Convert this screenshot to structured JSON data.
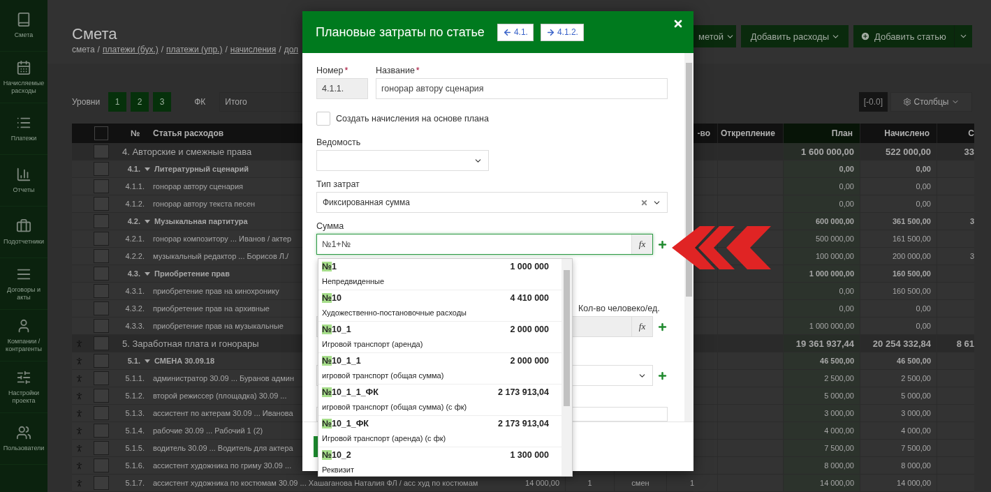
{
  "sidebar": {
    "items": [
      {
        "label": "Смета"
      },
      {
        "label": "Начисляемые расходы"
      },
      {
        "label": "Платежи"
      },
      {
        "label": "Отчеты"
      },
      {
        "label": "Подотчетники"
      },
      {
        "label": "Договоры и акты"
      },
      {
        "label": "Компании / контрагенты"
      },
      {
        "label": "Настройки проекта"
      },
      {
        "label": "Пользователи"
      }
    ]
  },
  "page": {
    "title": "Смета",
    "breadcrumbs": [
      {
        "label": "смета",
        "link": false
      },
      {
        "label": "платежи (бух.)",
        "link": true
      },
      {
        "label": "платежи (упр.)",
        "link": true
      },
      {
        "label": "начисления",
        "link": true
      },
      {
        "label": "дол",
        "link": true
      }
    ],
    "separator": "/"
  },
  "actions": [
    {
      "label": "метой",
      "kind": "dropdown"
    },
    {
      "label": "Добавить расходы",
      "kind": "dropdown"
    },
    {
      "label": "Добавить статью",
      "kind": "split"
    }
  ],
  "toolbar": {
    "levels_label": "Уровни",
    "levels": [
      "1",
      "2",
      "3"
    ],
    "fk_label": "ФК",
    "fk_value": "Итого",
    "precision": "[-0.0]",
    "columns_button": "Столбцы"
  },
  "table": {
    "header": {
      "checked": false,
      "number": "№",
      "name": "Статья расходов",
      "column_8": "-во",
      "detach": "Открепление",
      "plan": "План",
      "accrued": "Начислено",
      "column_12": "С"
    },
    "rows": [
      {
        "kind": "group",
        "person": false,
        "checked": false,
        "name": "4. Авторские и смежные права",
        "plan": "1 600 000,00",
        "accrued": "522 000,00",
        "column_12": "33"
      },
      {
        "kind": "subgroup",
        "person": false,
        "checked": false,
        "num": "4.1.",
        "name": "Литературный сценарий",
        "plan": "0,00",
        "accrued": "0,00"
      },
      {
        "kind": "item",
        "person": false,
        "checked": false,
        "num": "4.1.1.",
        "name": "гонорар автору сценария",
        "plan": "0,00",
        "accrued": "0,00"
      },
      {
        "kind": "item",
        "person": false,
        "checked": false,
        "num": "4.1.2.",
        "name": "гонорар автору текста песен",
        "plan": "0,00",
        "accrued": "0,00"
      },
      {
        "kind": "subgroup",
        "person": false,
        "checked": false,
        "num": "4.2.",
        "name": "Музыкальная партитура",
        "plan": "600 000,00",
        "accrued": "361 500,00",
        "column_12": "3"
      },
      {
        "kind": "item",
        "person": false,
        "checked": false,
        "num": "4.2.1.",
        "name": "гонорар композитору ... Иванов / актер",
        "plan": "500 000,00",
        "accrued": "161 500,00"
      },
      {
        "kind": "item",
        "person": false,
        "checked": false,
        "num": "4.2.2.",
        "name": "музыкальный редактор ... Борисов Л./",
        "plan": "100 000,00",
        "accrued": "200 000,00",
        "column_12": "3"
      },
      {
        "kind": "subgroup",
        "person": false,
        "checked": false,
        "num": "4.3.",
        "name": "Приобретение прав",
        "plan": "1 000 000,00",
        "accrued": "160 500,00"
      },
      {
        "kind": "item",
        "person": false,
        "checked": false,
        "num": "4.3.1.",
        "name": "приобретение прав на кинохронику",
        "plan": "0,00",
        "accrued": "160 500,00"
      },
      {
        "kind": "item",
        "person": false,
        "checked": false,
        "num": "4.3.2.",
        "name": "приобретение прав на архивные",
        "plan": "0,00",
        "accrued": "0,00"
      },
      {
        "kind": "item",
        "person": false,
        "checked": false,
        "num": "4.3.3.",
        "name": "приобретение прав на музыкальные",
        "plan": "1 000 000,00",
        "accrued": "0,00"
      },
      {
        "kind": "group",
        "person": true,
        "checked": false,
        "name": "5. Заработная плата и гонорары",
        "plan": "19 361 937,44",
        "accrued": "20 254 332,84",
        "column_12": "8 61"
      },
      {
        "kind": "subgroup",
        "person": true,
        "checked": false,
        "num": "5.1.",
        "name": "СМЕНА 30.09.18",
        "plan": "46 500,00",
        "accrued": "46 500,00"
      },
      {
        "kind": "item",
        "person": true,
        "checked": false,
        "num": "5.1.1.",
        "name": "администратор 30.09 ... Буранов админ",
        "plan": "2 500,00",
        "accrued": "2 500,00"
      },
      {
        "kind": "item",
        "person": true,
        "checked": false,
        "num": "5.1.2.",
        "name": "второй режиссер (площадка) 30.09 ...",
        "plan": "5 000,00",
        "accrued": "5 000,00"
      },
      {
        "kind": "item",
        "person": true,
        "checked": false,
        "num": "5.1.3.",
        "name": "ассистент по актерам 30.09 ... Иванова",
        "plan": "3 000,00",
        "accrued": "3 000,00"
      },
      {
        "kind": "item",
        "person": true,
        "checked": false,
        "num": "5.1.4.",
        "name": "рабочие 30.09 ... Рабочий 1 (2)",
        "plan": "4 000,00",
        "accrued": "4 000,00"
      },
      {
        "kind": "item",
        "person": true,
        "checked": false,
        "num": "5.1.5.",
        "name": "водитель 30.09 ... Водитель для актера",
        "plan": "7 500,00",
        "accrued": "7 500,00"
      },
      {
        "kind": "item",
        "person": true,
        "checked": false,
        "num": "5.1.6.",
        "name": "ассистент художника по гриму 30.09 ...",
        "plan": "8 000,00",
        "accrued": "8 000,00"
      },
      {
        "kind": "item",
        "person": true,
        "checked": false,
        "num": "5.1.7.",
        "name": "ассистент художника по костюмам 30.09 ... Хашаганова Наталия ФЛ / асс худ по костюмам",
        "price": "14 000,00",
        "qty": "1",
        "unit": "смен",
        "column_8": "1",
        "plan": "14 000,00",
        "accrued": "14 000,00"
      }
    ]
  },
  "modal": {
    "title": "Плановые затраты по статье",
    "prev": "4.1.",
    "next": "4.1.2.",
    "number": {
      "label": "Номер",
      "mark": "*",
      "value": "4.1.1.",
      "disabled": true
    },
    "name": {
      "label": "Название",
      "mark": "*",
      "value": "гонорар автору сценария"
    },
    "create_accruals": {
      "label": "Создать начисления на основе плана",
      "checked": false
    },
    "statement": {
      "label": "Ведомость"
    },
    "cost_type": {
      "label": "Тип затрат",
      "value": "Фиксированная сумма"
    },
    "sum": {
      "label": "Сумма",
      "value": "№1+№",
      "button": "fx",
      "focused": true
    },
    "qty": {
      "label": "Кол-во человеко/ед.",
      "button": "fx"
    },
    "suggestions": [
      {
        "match": "№",
        "rest": "1",
        "name": "Непредвиденные",
        "amount": "1 000 000"
      },
      {
        "match": "№",
        "rest": "10",
        "name": "Художественно-постановочные расходы",
        "amount": "4 410 000"
      },
      {
        "match": "№",
        "rest": "10_1",
        "name": "Игровой транспорт (аренда)",
        "amount": "2 000 000"
      },
      {
        "match": "№",
        "rest": "10_1_1",
        "name": "игровой транспорт (общая сумма)",
        "amount": "2 000 000"
      },
      {
        "match": "№",
        "rest": "10_1_1_ФК",
        "name": "игровой транспорт (общая сумма) (с фк)",
        "amount": "2 173 913,04"
      },
      {
        "match": "№",
        "rest": "10_1_ФК",
        "name": "Игровой транспорт (аренда) (с фк)",
        "amount": "2 173 913,04"
      },
      {
        "match": "№",
        "rest": "10_2",
        "name": "Реквизит",
        "amount": "1 300 000"
      }
    ]
  }
}
